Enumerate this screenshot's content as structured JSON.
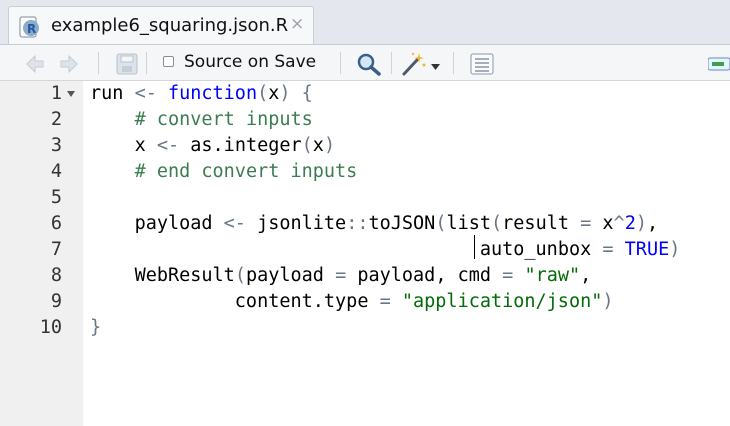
{
  "tab": {
    "title": "example6_squaring.json.R",
    "close": "×"
  },
  "toolbar": {
    "source_on_save_label": "Source on Save",
    "source_on_save_checked": false
  },
  "line_numbers": [
    "1",
    "2",
    "3",
    "4",
    "5",
    "6",
    "7",
    "8",
    "9",
    "10"
  ],
  "code": {
    "l1": [
      "run",
      " ",
      "<-",
      " ",
      "function",
      "(",
      "x",
      ")",
      " ",
      "{"
    ],
    "l2": [
      "    ",
      "# convert inputs"
    ],
    "l3": [
      "    ",
      "x",
      " ",
      "<-",
      " ",
      "as.integer",
      "(",
      "x",
      ")"
    ],
    "l4": [
      "    ",
      "# end convert inputs"
    ],
    "l6": [
      "    ",
      "payload",
      " ",
      "<-",
      " ",
      "jsonlite",
      "::",
      "toJSON",
      "(",
      "list",
      "(",
      "result",
      " ",
      "=",
      " ",
      "x",
      "^",
      "2",
      ")",
      ","
    ],
    "l7": [
      "                    ",
      "    ",
      "           ",
      "auto_unbox",
      " ",
      "=",
      " ",
      "TRUE",
      ")"
    ],
    "l8": [
      "    ",
      "WebResult",
      "(",
      "payload",
      " ",
      "=",
      " ",
      "payload",
      ",",
      " ",
      "cmd",
      " ",
      "=",
      " ",
      "\"raw\"",
      ","
    ],
    "l9": [
      "             ",
      "content.type",
      " ",
      "=",
      " ",
      "\"application/json\"",
      ")"
    ],
    "l10": [
      "}"
    ]
  },
  "colors": {
    "keyword": "#0000ff",
    "comment": "#3b7d50",
    "string": "#036a07",
    "operator": "#687687"
  }
}
